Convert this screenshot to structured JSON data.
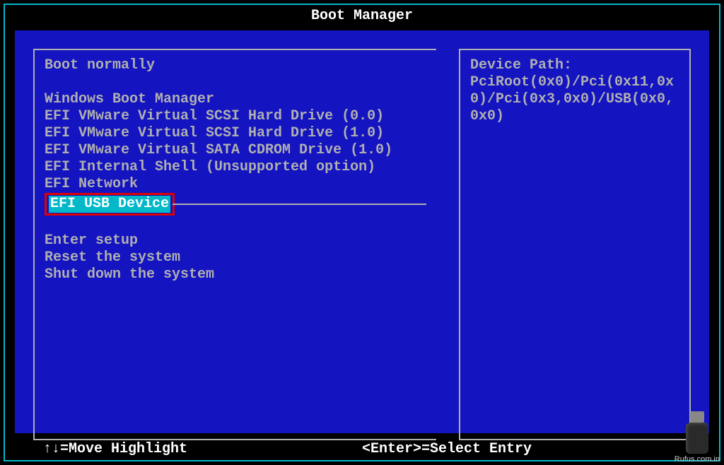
{
  "title": "Boot Manager",
  "left": {
    "top": "Boot normally",
    "entries": [
      "Windows Boot Manager",
      "EFI VMware Virtual SCSI Hard Drive (0.0)",
      "EFI VMware Virtual SCSI Hard Drive (1.0)",
      "EFI VMware Virtual SATA CDROM Drive (1.0)",
      "EFI Internal Shell (Unsupported option)",
      "EFI Network"
    ],
    "selected": "EFI USB Device",
    "bottom": [
      "Enter setup",
      "Reset the system",
      "Shut down the system"
    ]
  },
  "right": {
    "heading": "Device Path:",
    "path": "PciRoot(0x0)/Pci(0x11,0x0)/Pci(0x3,0x0)/USB(0x0,0x0)"
  },
  "help": {
    "nav": "↑↓=Move Highlight",
    "select": "<Enter>=Select Entry"
  },
  "watermark": "Rufus.com.in"
}
